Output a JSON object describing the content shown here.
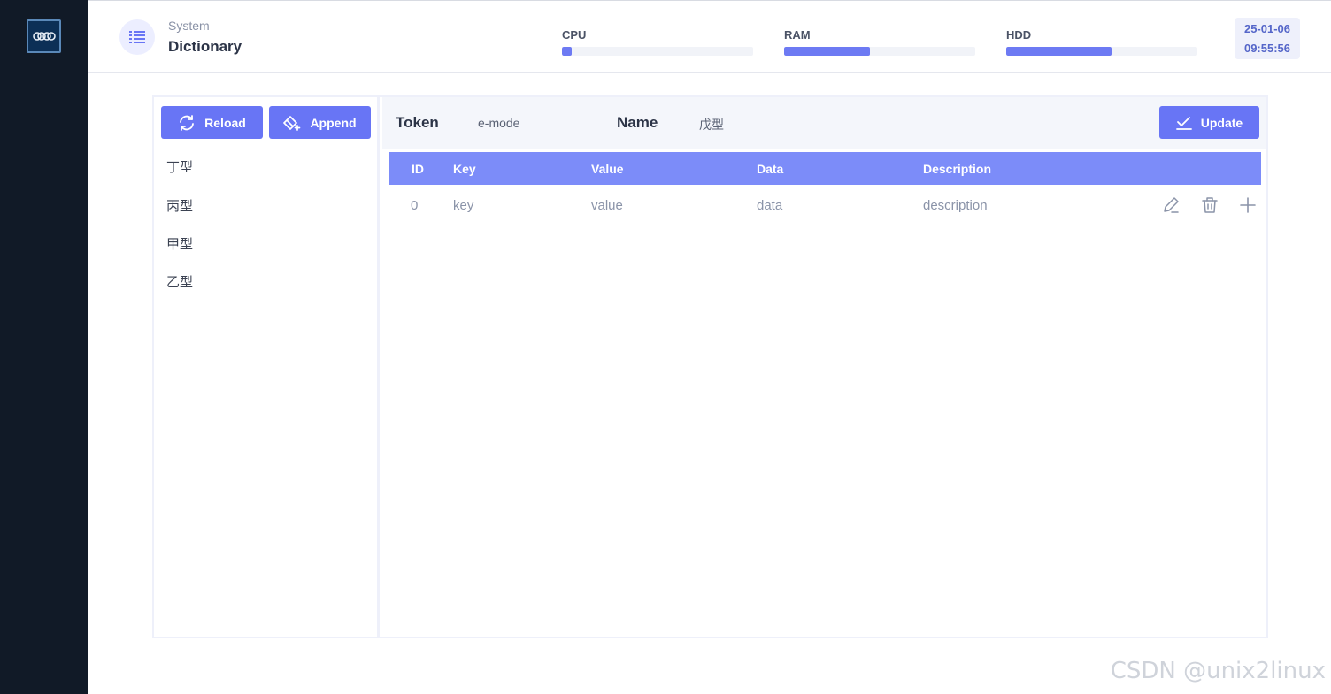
{
  "header": {
    "crumb_parent": "System",
    "crumb_title": "Dictionary",
    "meters": [
      {
        "label": "CPU",
        "percent": 5
      },
      {
        "label": "RAM",
        "percent": 45
      },
      {
        "label": "HDD",
        "percent": 55
      }
    ],
    "clock": {
      "date": "25-01-06",
      "time": "09:55:56"
    }
  },
  "left_panel": {
    "reload_label": "Reload",
    "append_label": "Append",
    "items": [
      "丁型",
      "丙型",
      "甲型",
      "乙型"
    ]
  },
  "detail": {
    "token_label": "Token",
    "token_value": "e-mode",
    "name_label": "Name",
    "name_value": "戊型",
    "update_label": "Update"
  },
  "table": {
    "columns": [
      "ID",
      "Key",
      "Value",
      "Data",
      "Description"
    ],
    "rows": [
      {
        "id": "0",
        "key": "key",
        "value": "value",
        "data": "data",
        "description": "description"
      }
    ]
  },
  "watermark": "CSDN @unix2linux",
  "colors": {
    "accent": "#6875f5",
    "sidebar": "#111a27",
    "table_head": "#7c8cf9"
  }
}
